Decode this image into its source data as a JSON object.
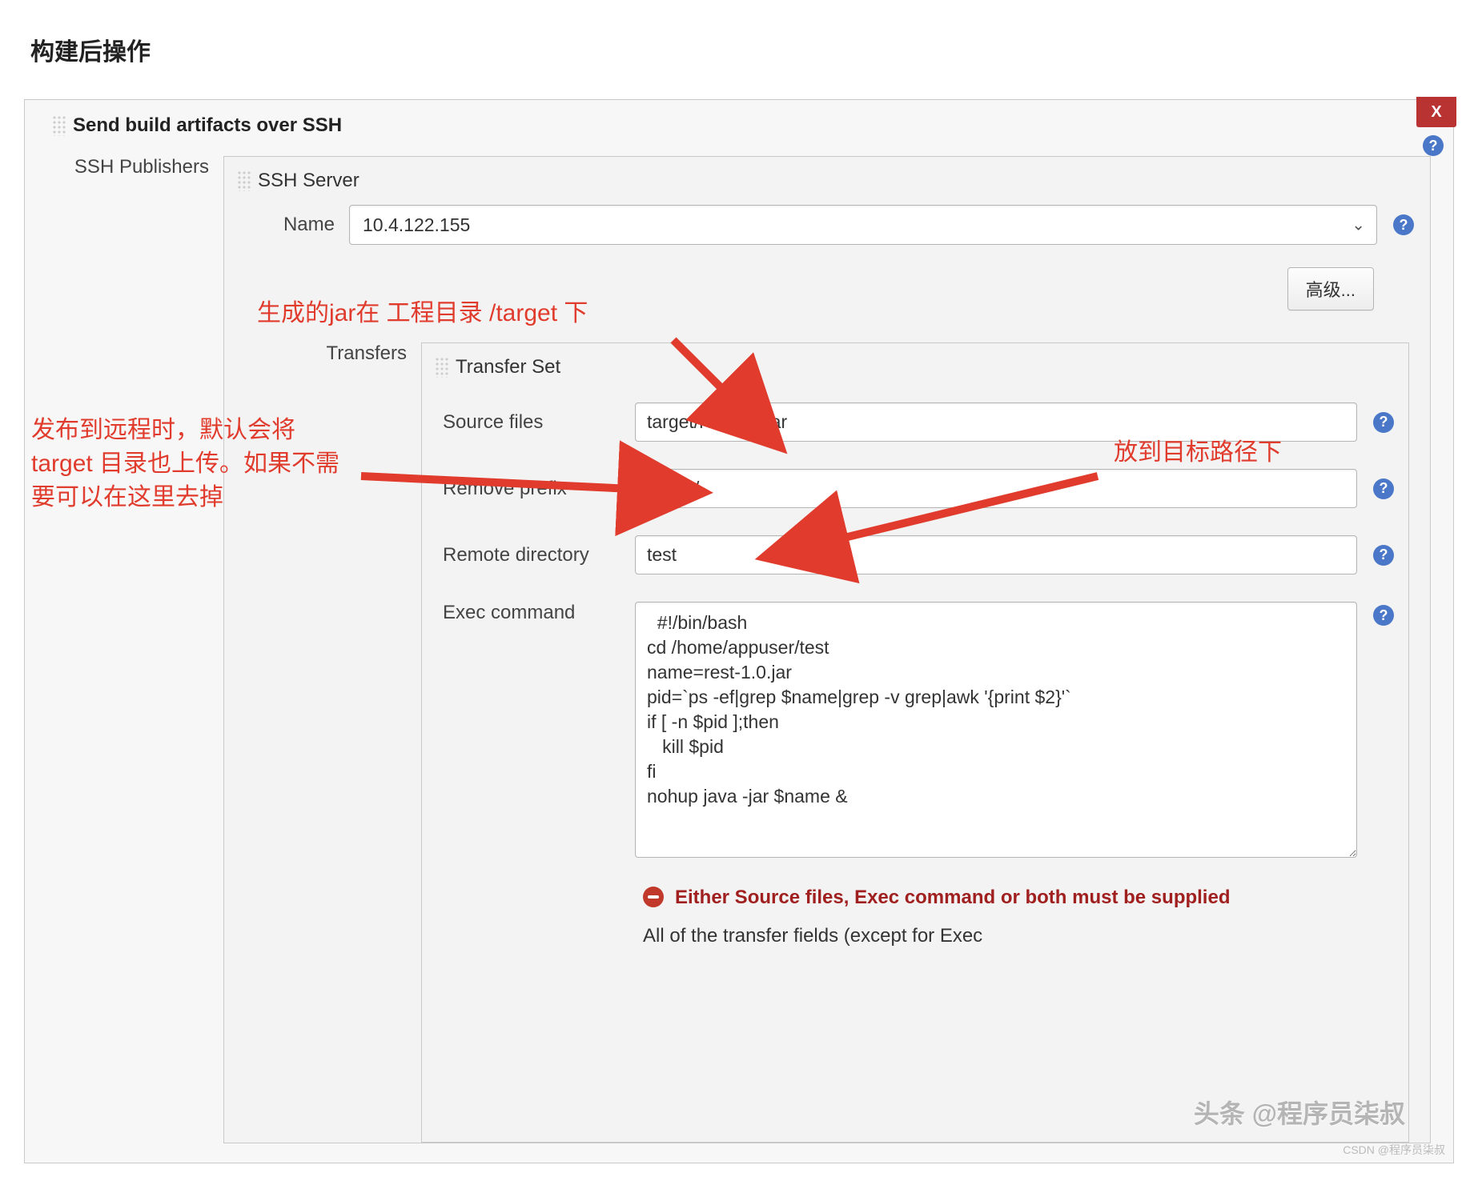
{
  "page": {
    "title": "构建后操作"
  },
  "section": {
    "title": "Send build artifacts over SSH",
    "close_label": "X",
    "ssh_publishers_label": "SSH Publishers",
    "ssh_server_label": "SSH Server",
    "name_label": "Name",
    "name_value": "10.4.122.155",
    "advanced_button": "高级...",
    "transfers_label": "Transfers",
    "transfer_set_label": "Transfer Set",
    "fields": {
      "source_files_label": "Source files",
      "source_files_value": "target/rest-1.0.jar",
      "remove_prefix_label": "Remove prefix",
      "remove_prefix_value": "target/",
      "remote_directory_label": "Remote directory",
      "remote_directory_value": "test",
      "exec_command_label": "Exec command",
      "exec_command_value": "  #!/bin/bash\ncd /home/appuser/test\nname=rest-1.0.jar\npid=`ps -ef|grep $name|grep -v grep|awk '{print $2}'`\nif [ -n $pid ];then\n   kill $pid\nfi\nnohup java -jar $name &"
    },
    "error_message": "Either Source files, Exec command or both must be supplied",
    "footnote": "All of the transfer fields (except for Exec"
  },
  "annotations": {
    "anno1": "生成的jar在 工程目录 /target 下",
    "anno2": "发布到远程时，默认会将target 目录也上传。如果不需要可以在这里去掉",
    "anno3": "放到目标路径下"
  },
  "watermark": {
    "line1": "头条 @程序员柒叔",
    "line2": "CSDN @程序员柒叔"
  }
}
